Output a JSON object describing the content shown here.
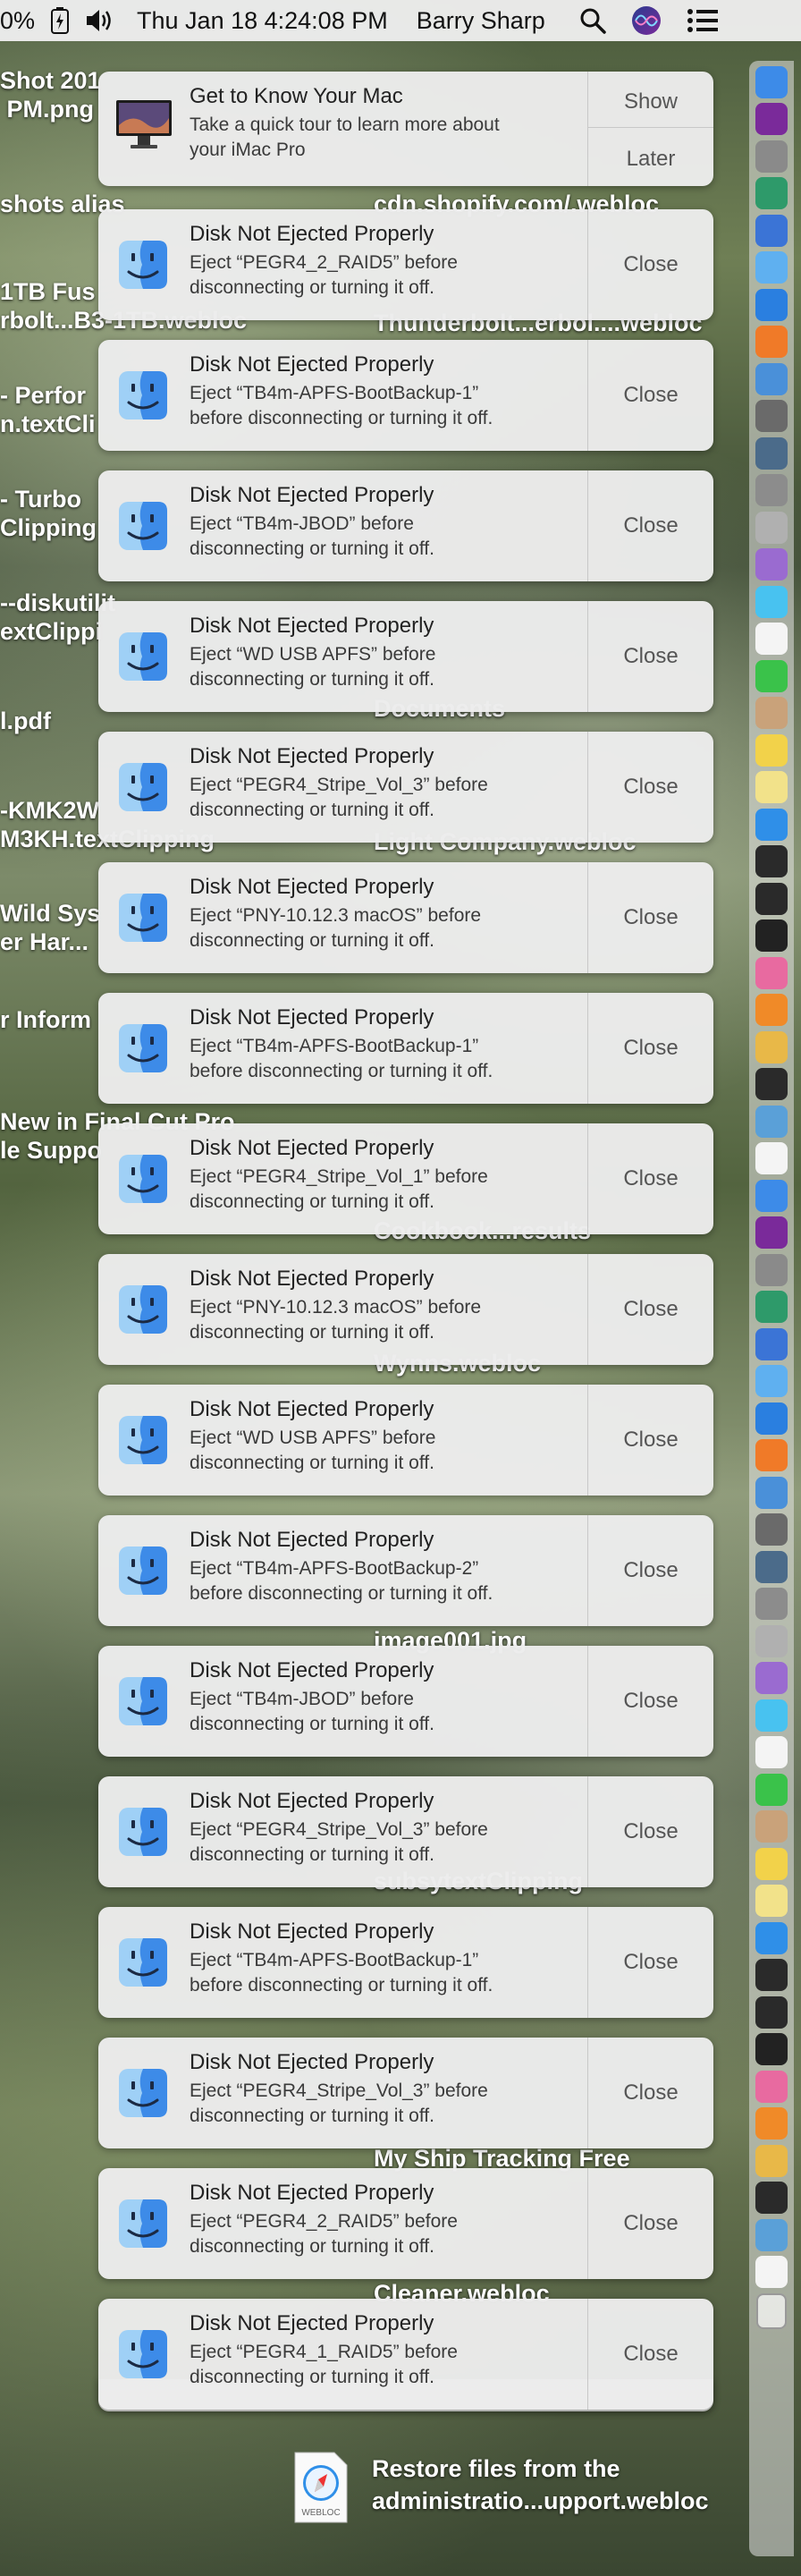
{
  "menubar": {
    "battery": "0%",
    "datetime": "Thu Jan 18  4:24:08 PM",
    "user": "Barry Sharp"
  },
  "desktop": {
    "left_labels": [
      "Shot 201\n PM.png",
      "shots alias",
      "1TB Fus\nrbolt...B3-1TB.webloc",
      "- Perfor\nn.textCli",
      "- Turbo\nClipping",
      "--diskutilit\nextClippi",
      "l.pdf",
      "-KMK2W\nM3KH.textClipping",
      "Wild Sys\ner Har...",
      "r Inform",
      "New in Final Cut Pro\nle Suppo"
    ],
    "center_labels": [
      "cdn.shopify.com/.webloc",
      "Thunderbolt...erbol....webloc",
      "Documents",
      "Light Company.webloc",
      "Cookbook...results",
      "Wynns.webloc",
      "image001.jpg",
      "subsytextClipping",
      "My Ship Tracking Free",
      "Cleaner.webloc"
    ],
    "bottom_file": {
      "name": "Restore files from the\nadministratio...upport.webloc",
      "badge": "WEBLOC"
    },
    "webloc_badge": "WEBLOC"
  },
  "notifications": [
    {
      "title": "Get to Know Your Mac",
      "body": "Take a quick tour to learn more about\nyour iMac Pro",
      "show": "Show",
      "later": "Later"
    }
  ],
  "disk_notices": [
    {
      "title": "Disk Not Ejected Properly",
      "body": "Eject “PEGR4_2_RAID5” before\ndisconnecting or turning it off.",
      "close": "Close"
    },
    {
      "title": "Disk Not Ejected Properly",
      "body": "Eject “TB4m-APFS-BootBackup-1”\nbefore disconnecting or turning it off.",
      "close": "Close"
    },
    {
      "title": "Disk Not Ejected Properly",
      "body": "Eject “TB4m-JBOD” before\ndisconnecting or turning it off.",
      "close": "Close"
    },
    {
      "title": "Disk Not Ejected Properly",
      "body": "Eject “WD USB APFS” before\ndisconnecting or turning it off.",
      "close": "Close"
    },
    {
      "title": "Disk Not Ejected Properly",
      "body": "Eject “PEGR4_Stripe_Vol_3” before\ndisconnecting or turning it off.",
      "close": "Close"
    },
    {
      "title": "Disk Not Ejected Properly",
      "body": "Eject “PNY-10.12.3 macOS” before\ndisconnecting or turning it off.",
      "close": "Close"
    },
    {
      "title": "Disk Not Ejected Properly",
      "body": "Eject “TB4m-APFS-BootBackup-1”\nbefore disconnecting or turning it off.",
      "close": "Close"
    },
    {
      "title": "Disk Not Ejected Properly",
      "body": "Eject “PEGR4_Stripe_Vol_1” before\ndisconnecting or turning it off.",
      "close": "Close"
    },
    {
      "title": "Disk Not Ejected Properly",
      "body": "Eject “PNY-10.12.3 macOS” before\ndisconnecting or turning it off.",
      "close": "Close"
    },
    {
      "title": "Disk Not Ejected Properly",
      "body": "Eject “WD USB APFS” before\ndisconnecting or turning it off.",
      "close": "Close"
    },
    {
      "title": "Disk Not Ejected Properly",
      "body": "Eject “TB4m-APFS-BootBackup-2”\nbefore disconnecting or turning it off.",
      "close": "Close"
    },
    {
      "title": "Disk Not Ejected Properly",
      "body": "Eject “TB4m-JBOD” before\ndisconnecting or turning it off.",
      "close": "Close"
    },
    {
      "title": "Disk Not Ejected Properly",
      "body": "Eject “PEGR4_Stripe_Vol_3” before\ndisconnecting or turning it off.",
      "close": "Close"
    },
    {
      "title": "Disk Not Ejected Properly",
      "body": "Eject “TB4m-APFS-BootBackup-1”\nbefore disconnecting or turning it off.",
      "close": "Close"
    },
    {
      "title": "Disk Not Ejected Properly",
      "body": "Eject “PEGR4_Stripe_Vol_3” before\ndisconnecting or turning it off.",
      "close": "Close"
    },
    {
      "title": "Disk Not Ejected Properly",
      "body": "Eject “PEGR4_2_RAID5” before\ndisconnecting or turning it off.",
      "close": "Close"
    },
    {
      "title": "Disk Not Ejected Properly",
      "body": "Eject “PEGR4_1_RAID5” before\ndisconnecting or turning it off.",
      "close": "Close"
    }
  ],
  "dock_icons": [
    "finder-icon",
    "siri-icon",
    "system-prefs-icon",
    "time-machine-icon",
    "app-icon",
    "app-icon",
    "safari-icon",
    "firefox-icon",
    "app-icon",
    "launchpad-icon",
    "app-icon",
    "app-icon",
    "app-icon",
    "app-icon",
    "messages-icon",
    "calendar-icon",
    "facetime-icon",
    "contacts-icon",
    "notes-icon",
    "stickies-icon",
    "app-store-icon",
    "activity-monitor-icon",
    "terminal-icon",
    "app-icon",
    "itunes-icon",
    "ibooks-icon",
    "photos-icon",
    "quicktime-icon",
    "preview-icon",
    "textedit-icon",
    "app-icon",
    "app-icon",
    "app-icon",
    "app-icon",
    "app-icon",
    "app-icon",
    "app-icon",
    "app-icon",
    "app-icon",
    "excel-icon",
    "app-icon",
    "app-icon",
    "skype-icon",
    "app-icon",
    "app-icon",
    "app-icon",
    "app-icon",
    "app-icon",
    "app-icon",
    "app-icon",
    "app-icon",
    "app-icon",
    "app-icon",
    "app-icon",
    "app-icon",
    "app-icon",
    "app-icon",
    "app-icon",
    "app-icon",
    "app-icon",
    "trash-icon"
  ],
  "colors": {
    "close_text": "#555555",
    "finder_blue": "#3d8be8",
    "finder_light": "#9fd0f6"
  }
}
